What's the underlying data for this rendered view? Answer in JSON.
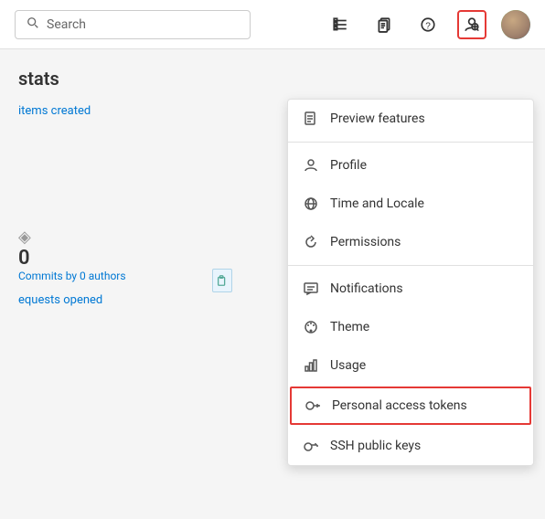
{
  "header": {
    "search_placeholder": "Search",
    "icons": {
      "list_icon": "≡",
      "clipboard_icon": "📋",
      "help_icon": "?",
      "user_icon": "👤"
    }
  },
  "page": {
    "stats_title": "stats",
    "items_created_link": "items created",
    "commits_count": "0",
    "commits_label": "Commits by 0 authors",
    "requests_link": "equests opened"
  },
  "dropdown": {
    "items": [
      {
        "id": "preview-features",
        "label": "Preview features",
        "icon": "page"
      },
      {
        "id": "profile",
        "label": "Profile",
        "icon": "person"
      },
      {
        "id": "time-locale",
        "label": "Time and Locale",
        "icon": "globe"
      },
      {
        "id": "permissions",
        "label": "Permissions",
        "icon": "refresh"
      },
      {
        "id": "notifications",
        "label": "Notifications",
        "icon": "chat"
      },
      {
        "id": "theme",
        "label": "Theme",
        "icon": "palette"
      },
      {
        "id": "usage",
        "label": "Usage",
        "icon": "bars"
      },
      {
        "id": "personal-access-tokens",
        "label": "Personal access tokens",
        "icon": "token",
        "highlighted": true
      },
      {
        "id": "ssh-public-keys",
        "label": "SSH public keys",
        "icon": "key"
      }
    ]
  },
  "colors": {
    "highlight_border": "#e53935",
    "link_color": "#0078d4"
  }
}
